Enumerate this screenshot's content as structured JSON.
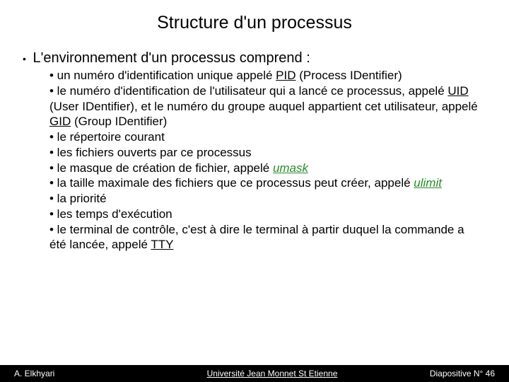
{
  "title": "Structure d'un processus",
  "lead": "L'environnement d'un processus comprend :",
  "items": {
    "i1a": "• un numéro d'identification unique appelé ",
    "i1b": "PID",
    "i1c": " (Process IDentifier)",
    "i2a": "• le numéro d'identification de l'utilisateur qui a lancé ce processus, appelé ",
    "i2b": "UID",
    "i2c": " (User IDentifier), et le numéro du groupe auquel appartient cet utilisateur, appelé ",
    "i2d": "GID",
    "i2e": " (Group IDentifier)",
    "i3": "• le répertoire courant",
    "i4": "• les fichiers ouverts par ce processus",
    "i5a": "• le masque de création de fichier, appelé ",
    "i5b": "umask",
    "i6a": "• la taille maximale des fichiers que ce processus peut créer, appelé ",
    "i6b": "ulimit",
    "i7": "• la priorité",
    "i8": "• les temps d'exécution",
    "i9a": "• le terminal de contrôle, c'est à dire le terminal à partir duquel la commande a été lancée, appelé ",
    "i9b": "TTY"
  },
  "footer": {
    "author": "A. Elkhyari",
    "org": "Université Jean Monnet St Etienne",
    "page": "Diapositive N° 46"
  }
}
